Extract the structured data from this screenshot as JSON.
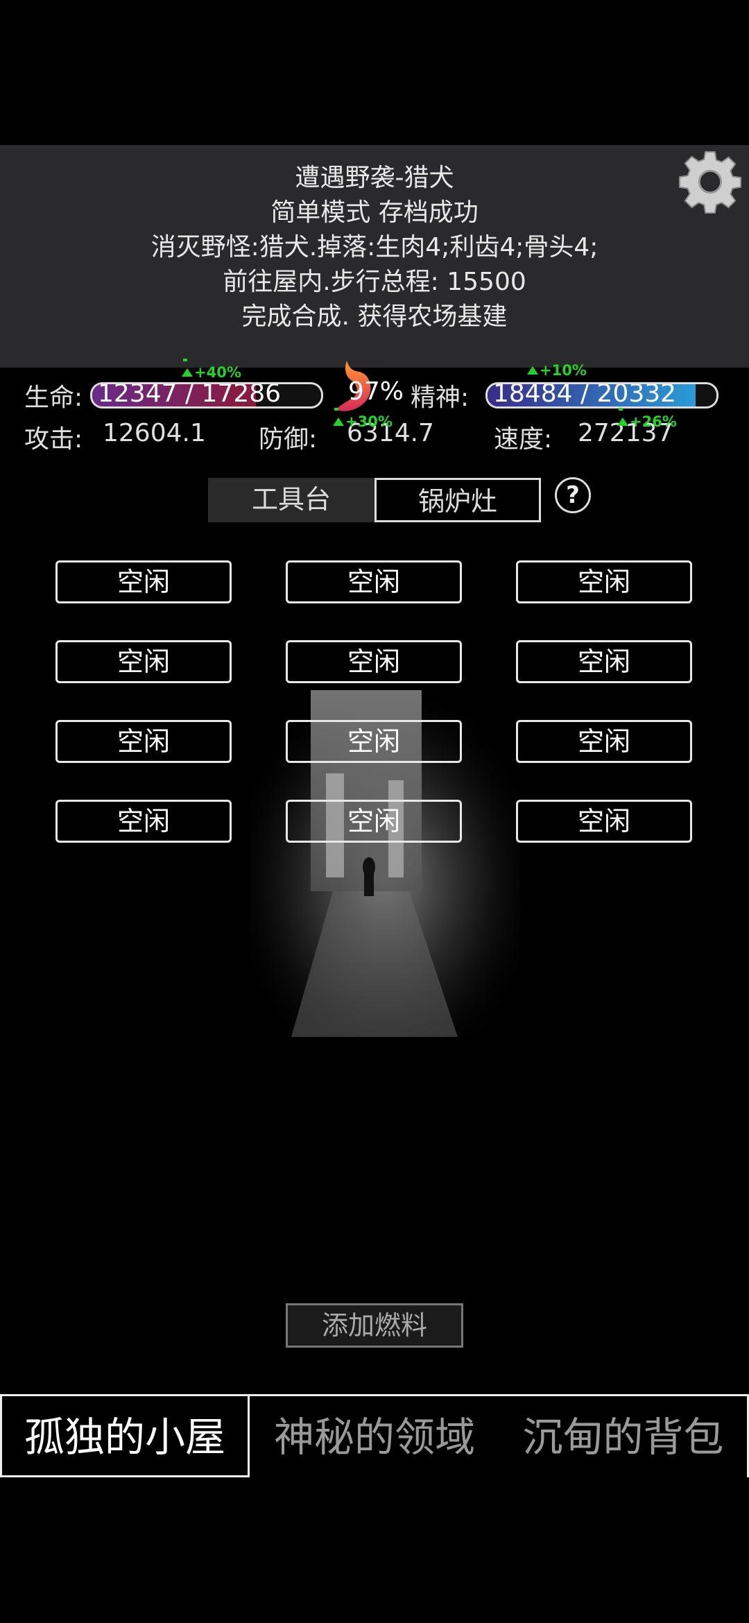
{
  "header": {
    "log_lines": [
      "遭遇野袭-猎犬",
      "简单模式 存档成功",
      "消灭野怪:猎犬.掉落:生肉4;利齿4;骨头4;",
      "前往屋内.步行总程: 15500",
      "完成合成. 获得农场基建"
    ],
    "moon_icon": "crescent-moon-icon",
    "settings_icon": "gear-icon"
  },
  "stats": {
    "hp_label": "生命:",
    "hp_value": "12347 / 17286",
    "hp_fraction": 0.714,
    "hp_buff": "+40%",
    "hunger_percent": "97%",
    "spirit_label": "精神:",
    "spirit_value": "18484 / 20332",
    "spirit_fraction": 0.909,
    "spirit_buff": "+10%",
    "attack_label": "攻击:",
    "attack_value": "12604.1",
    "defense_label": "防御:",
    "defense_value": "6314.7",
    "defense_buff": "+30%",
    "speed_label": "速度:",
    "speed_value": "272137",
    "speed_buff": "+26%",
    "colors": {
      "hp_fill": "#8b1a3a",
      "spirit_fill": "#3a2b8a",
      "buff": "#22d32a"
    }
  },
  "tabs": {
    "workbench": "工具台",
    "stove": "锅炉灶",
    "help": "?"
  },
  "slots": [
    "空闲",
    "空闲",
    "空闲",
    "空闲",
    "空闲",
    "空闲",
    "空闲",
    "空闲",
    "空闲",
    "空闲",
    "空闲",
    "空闲"
  ],
  "actions": {
    "add_fuel": "添加燃料"
  },
  "nav": {
    "cabin": "孤独的小屋",
    "realm": "神秘的领域",
    "bag": "沉甸的背包"
  }
}
